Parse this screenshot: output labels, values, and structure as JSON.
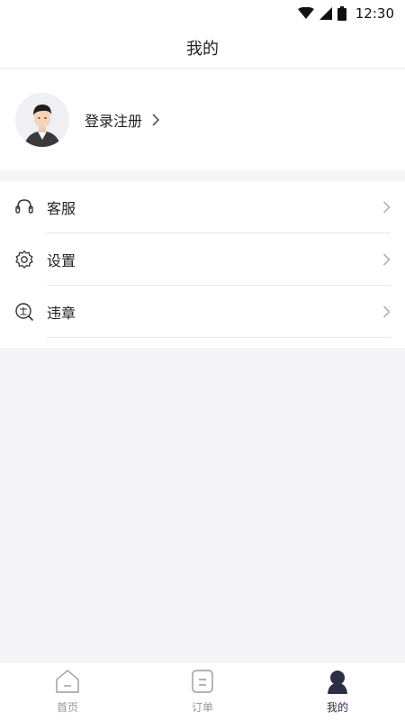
{
  "status_bar": {
    "time": "12:30"
  },
  "header": {
    "title": "我的"
  },
  "profile": {
    "login_label": "登录注册"
  },
  "menu": {
    "items": [
      {
        "label": "客服",
        "icon": "headset-icon"
      },
      {
        "label": "设置",
        "icon": "gear-icon"
      },
      {
        "label": "违章",
        "icon": "violation-search-icon"
      }
    ]
  },
  "bottom_nav": {
    "items": [
      {
        "label": "首页",
        "icon": "home-icon",
        "active": false
      },
      {
        "label": "订单",
        "icon": "order-icon",
        "active": false
      },
      {
        "label": "我的",
        "icon": "user-icon",
        "active": true
      }
    ],
    "active_color": "#2b2f45",
    "inactive_color": "#999999"
  }
}
